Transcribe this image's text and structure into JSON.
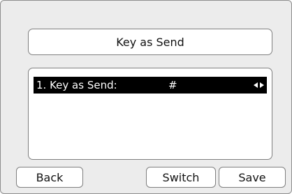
{
  "screen": {
    "title": "Key as Send"
  },
  "list": {
    "items": [
      {
        "label": "1. Key as Send:",
        "value": "#",
        "selected": true,
        "control": "left-right-arrows-icon"
      }
    ]
  },
  "softkeys": {
    "back": "Back",
    "switch": "Switch",
    "save": "Save"
  },
  "colors": {
    "background": "#ececec",
    "panel": "#ffffff",
    "selected_row": "#000000",
    "selected_text": "#ffffff",
    "border": "#7f7f7f"
  }
}
